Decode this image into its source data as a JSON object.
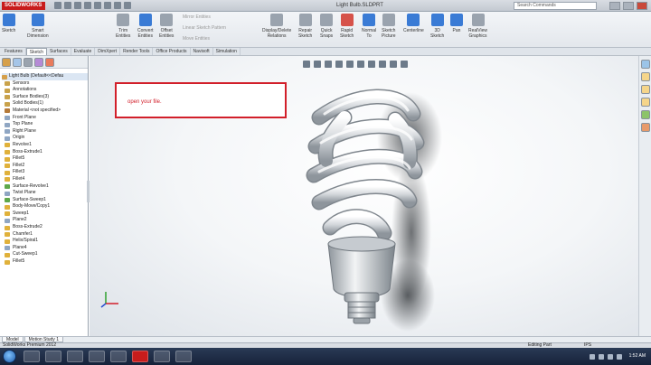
{
  "window": {
    "app_logo": "SOLIDWORKS",
    "title": "Light Bulb.SLDPRT",
    "search_placeholder": "Search Commands"
  },
  "ribbon": {
    "buttons": [
      {
        "label": "Sketch",
        "icon": "sketch-icon",
        "color": "#3a7bd5"
      },
      {
        "label": "Smart\nDimension",
        "icon": "dimension-icon",
        "color": "#3a7bd5"
      },
      {
        "label": "Trim\nEntities",
        "icon": "trim-icon",
        "color": "#9aa3ae"
      },
      {
        "label": "Convert\nEntities",
        "icon": "convert-icon",
        "color": "#3a7bd5"
      },
      {
        "label": "Offset\nEntities",
        "icon": "offset-icon",
        "color": "#9aa3ae"
      },
      {
        "label": "Display/Delete\nRelations",
        "icon": "relations-icon",
        "color": "#9aa3ae"
      },
      {
        "label": "Repair\nSketch",
        "icon": "repair-icon",
        "color": "#9aa3ae"
      },
      {
        "label": "Quick\nSnaps",
        "icon": "snaps-icon",
        "color": "#9aa3ae"
      },
      {
        "label": "Rapid\nSketch",
        "icon": "rapid-icon",
        "color": "#d6524a"
      },
      {
        "label": "Normal\nTo",
        "icon": "normal-icon",
        "color": "#3a7bd5"
      },
      {
        "label": "Sketch\nPicture",
        "icon": "picture-icon",
        "color": "#9aa3ae"
      },
      {
        "label": "Centerline",
        "icon": "centerline-icon",
        "color": "#3a7bd5"
      },
      {
        "label": "3D\nSketch",
        "icon": "sketch3d-icon",
        "color": "#3a7bd5"
      },
      {
        "label": "Pan",
        "icon": "pan-icon",
        "color": "#3a7bd5"
      },
      {
        "label": "RealView\nGraphics",
        "icon": "realview-icon",
        "color": "#9aa3ae"
      }
    ],
    "mirror": "Mirror Entities",
    "linear_pattern": "Linear Sketch Pattern",
    "move": "Move Entities"
  },
  "tabs": [
    "Features",
    "Sketch",
    "Surfaces",
    "Evaluate",
    "DimXpert",
    "Render Tools",
    "Office Products",
    "Navisoft",
    "Simulation"
  ],
  "active_tab": "Sketch",
  "tree": {
    "root": "Light Bulb (Default<<Defau",
    "items": [
      {
        "label": "Sensors",
        "color": "#c9a24b"
      },
      {
        "label": "Annotations",
        "color": "#c9a24b"
      },
      {
        "label": "Surface Bodies(3)",
        "color": "#c9a24b"
      },
      {
        "label": "Solid Bodies(1)",
        "color": "#c9a24b"
      },
      {
        "label": "Material <not specified>",
        "color": "#b57a3a"
      },
      {
        "label": "Front Plane",
        "color": "#8fa6c3"
      },
      {
        "label": "Top Plane",
        "color": "#8fa6c3"
      },
      {
        "label": "Right Plane",
        "color": "#8fa6c3"
      },
      {
        "label": "Origin",
        "color": "#8fa6c3"
      },
      {
        "label": "Revolve1",
        "color": "#e0b13b"
      },
      {
        "label": "Boss-Extrude1",
        "color": "#e0b13b"
      },
      {
        "label": "Fillet5",
        "color": "#e0b13b"
      },
      {
        "label": "Fillet2",
        "color": "#e0b13b"
      },
      {
        "label": "Fillet3",
        "color": "#e0b13b"
      },
      {
        "label": "Fillet4",
        "color": "#e0b13b"
      },
      {
        "label": "Surface-Revolve1",
        "color": "#5fa84a"
      },
      {
        "label": "Twist Plane",
        "color": "#8fa6c3"
      },
      {
        "label": "Surface-Sweep1",
        "color": "#5fa84a"
      },
      {
        "label": "Body-Move/Copy1",
        "color": "#e0b13b"
      },
      {
        "label": "Sweep1",
        "color": "#e0b13b"
      },
      {
        "label": "Plane2",
        "color": "#8fa6c3"
      },
      {
        "label": "Boss-Extrude2",
        "color": "#e0b13b"
      },
      {
        "label": "Chamfer1",
        "color": "#e0b13b"
      },
      {
        "label": "Helix/Spiral1",
        "color": "#e0b13b"
      },
      {
        "label": "Plane4",
        "color": "#8fa6c3"
      },
      {
        "label": "Cut-Sweep1",
        "color": "#e0b13b"
      },
      {
        "label": "Fillet5",
        "color": "#e0b13b"
      }
    ]
  },
  "bottom_tabs": [
    "Model",
    "Motion Study 1"
  ],
  "viewport": {
    "callout_text": "open your file.",
    "callout_color": "#d21f2a"
  },
  "status": {
    "left": "SolidWorks Premium 2012",
    "mode": "Editing Part",
    "units": "IPS"
  },
  "taskbar": {
    "time": "1:52 AM"
  }
}
